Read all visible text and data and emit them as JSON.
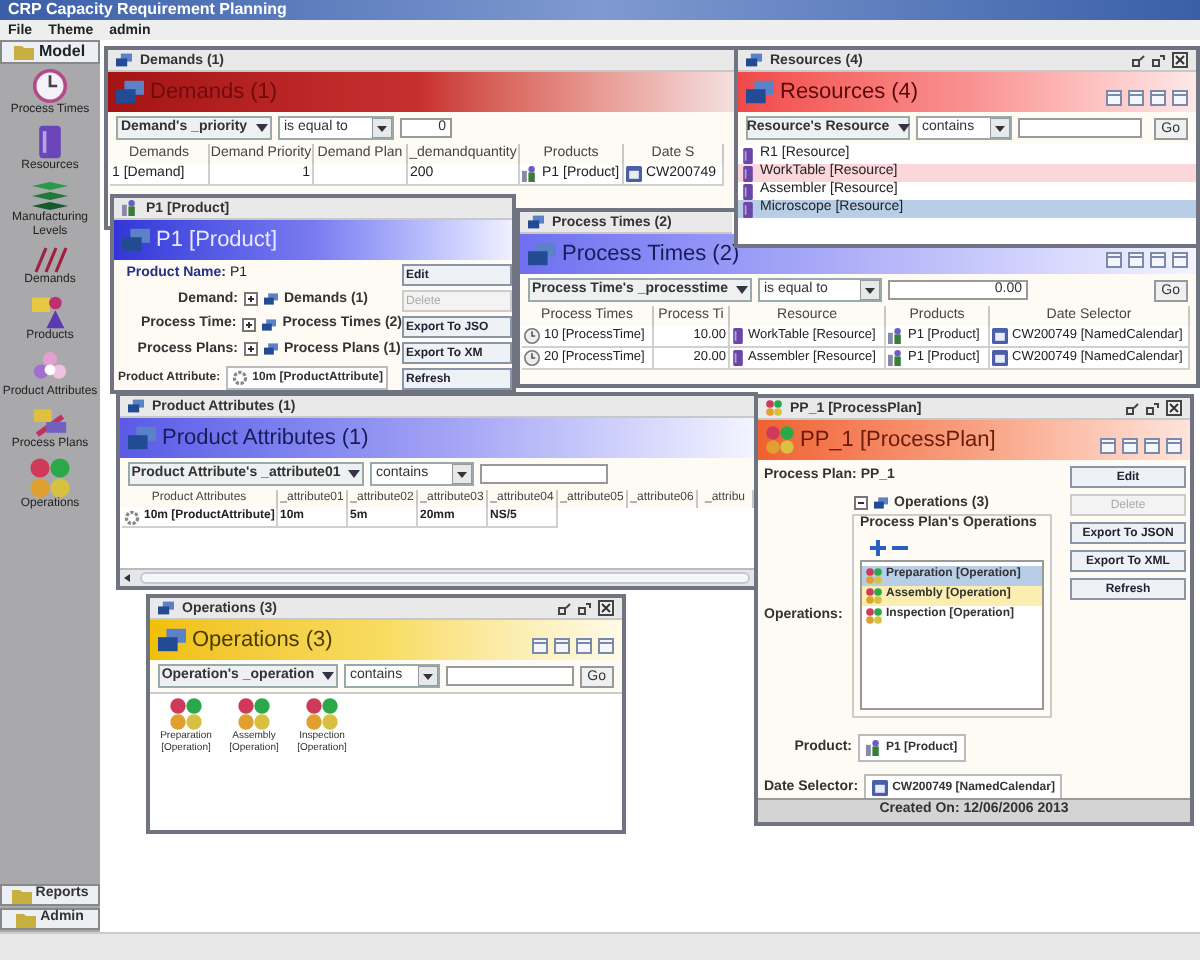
{
  "app_title": "CRP Capacity Requirement Planning",
  "menu": [
    "File",
    "Theme",
    "admin"
  ],
  "sidebar": {
    "tab": "Model",
    "items": [
      {
        "label": "Process Times",
        "kind": "clock"
      },
      {
        "label": "Resources",
        "kind": "bin"
      },
      {
        "label": "Manufacturing Levels",
        "kind": "layers"
      },
      {
        "label": "Demands",
        "kind": "slashes"
      },
      {
        "label": "Products",
        "kind": "product"
      },
      {
        "label": "Product Attributes",
        "kind": "attribute"
      },
      {
        "label": "Process Plans",
        "kind": "plan"
      },
      {
        "label": "Operations",
        "kind": "operation"
      }
    ],
    "bottom_tabs": [
      "Reports",
      "Admin"
    ]
  },
  "demands": {
    "title": "Demands (1)",
    "header": "Demands (1)",
    "filter": {
      "field": "Demand's _priority",
      "operator": "is equal to",
      "value": "0"
    },
    "columns": [
      "Demands",
      "Demand Priority",
      "Demand Plan",
      "_demandquantity",
      "Products",
      "Date S"
    ],
    "rows": [
      {
        "demand": "1 [Demand]",
        "priority": "1",
        "quantity": "200",
        "product": "P1 [Product]",
        "date": "CW200749"
      }
    ]
  },
  "resources": {
    "title": "Resources (4)",
    "header": "Resources (4)",
    "filter": {
      "field": "Resource's Resource",
      "operator": "contains",
      "go": "Go"
    },
    "items": [
      {
        "label": "R1 [Resource]",
        "selected": false,
        "hovered": false
      },
      {
        "label": "WorkTable [Resource]",
        "selected": false,
        "hovered": true
      },
      {
        "label": "Assembler [Resource]",
        "selected": false,
        "hovered": false
      },
      {
        "label": "Microscope [Resource]",
        "selected": true,
        "hovered": false
      }
    ]
  },
  "product": {
    "title": "P1 [Product]",
    "header": "P1 [Product]",
    "name_label": "Product Name:",
    "name": "P1",
    "links": [
      {
        "label": "Demand:",
        "value": "Demands (1)",
        "expanded": false
      },
      {
        "label": "Process Time:",
        "value": "Process Times (2)",
        "expanded": false
      },
      {
        "label": "Process Plans:",
        "value": "Process Plans (1)",
        "expanded": false
      }
    ],
    "attribute_label": "Product Attribute:",
    "attribute": "10m [ProductAttribute]",
    "buttons": [
      {
        "label": "Edit",
        "disabled": false
      },
      {
        "label": "Delete",
        "disabled": true
      },
      {
        "label": "Export To JSO",
        "disabled": false
      },
      {
        "label": "Export To XM",
        "disabled": false
      },
      {
        "label": "Refresh",
        "disabled": false
      }
    ]
  },
  "process_times": {
    "title": "Process Times (2)",
    "header": "Process Times (2)",
    "filter": {
      "field": "Process Time's _processtime",
      "operator": "is equal to",
      "value": "0.00",
      "go": "Go"
    },
    "columns": [
      "Process Times",
      "Process Ti",
      "Resource",
      "Products",
      "Date Selector"
    ],
    "rows": [
      {
        "process_time": "10 [ProcessTime]",
        "value": "10.00",
        "resource": "WorkTable [Resource]",
        "product": "P1 [Product]",
        "date": "CW200749 [NamedCalendar]"
      },
      {
        "process_time": "20 [ProcessTime]",
        "value": "20.00",
        "resource": "Assembler [Resource]",
        "product": "P1 [Product]",
        "date": "CW200749 [NamedCalendar]"
      }
    ]
  },
  "product_attributes": {
    "title": "Product Attributes (1)",
    "header": "Product Attributes (1)",
    "filter": {
      "field": "Product Attribute's _attribute01",
      "operator": "contains"
    },
    "columns": [
      "Product Attributes",
      "_attribute01",
      "_attribute02",
      "_attribute03",
      "_attribute04",
      "_attribute05",
      "_attribute06",
      "_attribu"
    ],
    "rows": [
      [
        "10m [ProductAttribute]",
        "10m",
        "5m",
        "20mm",
        "NS/5"
      ]
    ]
  },
  "process_plan": {
    "title": "PP_1 [ProcessPlan]",
    "header": "PP_1 [ProcessPlan]",
    "plan_label": "Process Plan:",
    "plan": "PP_1",
    "tree": {
      "label": "Operations (3)",
      "expanded": true
    },
    "group_title": "Process Plan's Operations",
    "operations_label": "Operations:",
    "operations": [
      {
        "label": "Preparation [Operation]",
        "selected": true,
        "hovered": false
      },
      {
        "label": "Assembly [Operation]",
        "selected": false,
        "hovered": true
      },
      {
        "label": "Inspection [Operation]",
        "selected": false,
        "hovered": false
      }
    ],
    "product_label": "Product:",
    "product": "P1 [Product]",
    "date_label": "Date Selector:",
    "date": "CW200749 [NamedCalendar]",
    "buttons": [
      {
        "label": "Edit",
        "disabled": false
      },
      {
        "label": "Delete",
        "disabled": true
      },
      {
        "label": "Export To JSON",
        "disabled": false
      },
      {
        "label": "Export To XML",
        "disabled": false
      },
      {
        "label": "Refresh",
        "disabled": false
      }
    ],
    "footer": "Created On: 12/06/2006 2013"
  },
  "operations": {
    "title": "Operations (3)",
    "header": "Operations (3)",
    "filter": {
      "field": "Operation's _operation",
      "operator": "contains",
      "go": "Go"
    },
    "items": [
      {
        "label": "Preparation [Operation]"
      },
      {
        "label": "Assembly [Operation]"
      },
      {
        "label": "Inspection [Operation]"
      }
    ]
  }
}
